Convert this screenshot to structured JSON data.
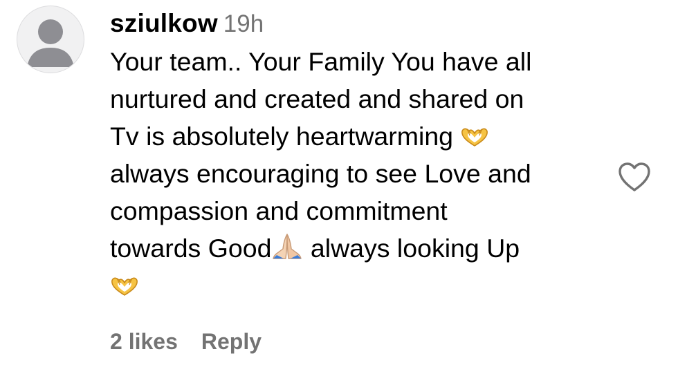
{
  "comment": {
    "username": "sziulkow",
    "time": "19h",
    "lines": [
      "Your team.. Your Family You have all",
      "nurtured and created and shared on",
      "Tv is absolutely heartwarming",
      "always encouraging to see Love and",
      "compassion and commitment",
      "towards Good",
      "always looking Up"
    ],
    "emojis": {
      "heart_hands": "heart-hands-emoji",
      "praying_hands": "praying-hands-emoji"
    },
    "likes": "2 likes",
    "reply_label": "Reply",
    "like_icon": "heart-outline-icon",
    "avatar_icon": "default-avatar-icon"
  },
  "colors": {
    "text": "#000000",
    "secondary": "#737373",
    "avatar_bg": "#f1f1f2",
    "avatar_fg": "#8e8e93"
  }
}
